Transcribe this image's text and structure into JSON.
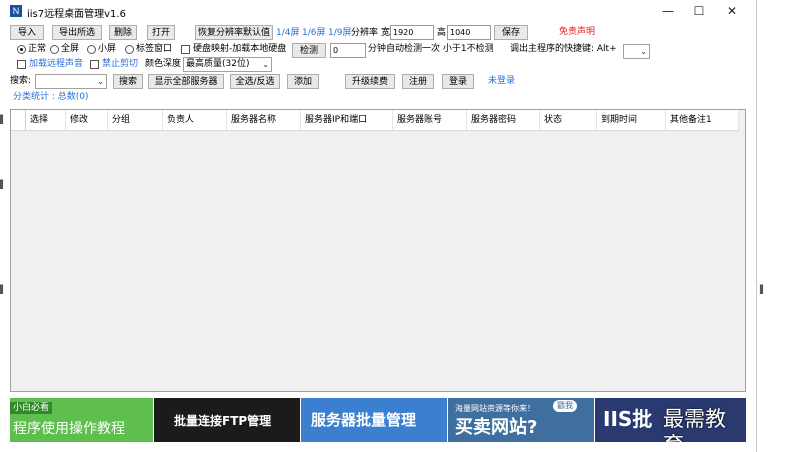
{
  "window": {
    "title": "iis7远程桌面管理v1.6",
    "icon_text": "N"
  },
  "toolbar": {
    "import": "导入",
    "export_selected": "导出所选",
    "delete": "删除",
    "open": "打开",
    "restore_resolution": "恢复分辨率默认值",
    "screen_fractions": [
      "1/4屏",
      "1/6屏",
      "1/9屏"
    ],
    "resolution_label": "分辨率",
    "width_label": "宽",
    "width_value": "1920",
    "height_label": "高",
    "height_value": "1040",
    "save": "保存",
    "disclaimer": "免责声明"
  },
  "options": {
    "modes": [
      "正常",
      "全屏",
      "小屏",
      "标签窗口"
    ],
    "selected_mode": "正常",
    "disk_map": "硬盘映射-加载本地硬盘",
    "detect": "检测",
    "interval_value": "0",
    "interval_text": "分钟自动检测一次 小于1不检测",
    "shortcut_label": "调出主程序的快捷键: Alt+",
    "load_sound": "加载远程声音",
    "no_clipboard": "禁止剪切",
    "color_depth_label": "颜色深度",
    "color_depth_value": "最高质量(32位)"
  },
  "search": {
    "label": "搜索:",
    "search_btn": "搜索",
    "show_all": "显示全部服务器",
    "select_all": "全选/反选",
    "add": "添加",
    "upgrade": "升级续费",
    "register": "注册",
    "login": "登录",
    "login_status": "未登录"
  },
  "stats": {
    "text": "分类统计 : 总数(0)"
  },
  "table": {
    "columns": [
      "选择",
      "修改",
      "分组",
      "负责人",
      "服务器名称",
      "服务器IP和端口",
      "服务器账号",
      "服务器密码",
      "状态",
      "到期时间",
      "其他备注1"
    ],
    "rows": []
  },
  "banners": {
    "b1_tag": "小白必看",
    "b1_text": "程序使用操作教程",
    "b2_text": "批量连接FTP管理",
    "b3_text": "服务器批量管理",
    "b4_small": "海量网站资源等你来！",
    "b4_badge": "戳我",
    "b4_big": "买卖网站?",
    "b5_text": "IIS批",
    "watermark": "最需教育"
  },
  "window_controls": {
    "minimize": "—",
    "maximize": "☐",
    "close": "✕"
  }
}
